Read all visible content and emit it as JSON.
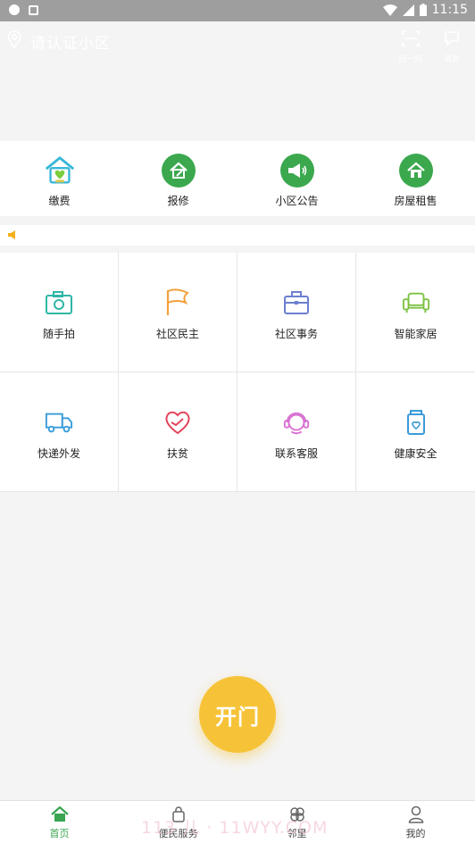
{
  "status_bar": {
    "time": "11:15"
  },
  "header": {
    "location_title": "请认证小区",
    "scan_label": "扫一扫",
    "message_label": "消息"
  },
  "quick_actions": [
    {
      "label": "缴费",
      "icon": "house-heart-icon"
    },
    {
      "label": "报修",
      "icon": "repair-house-icon"
    },
    {
      "label": "小区公告",
      "icon": "megaphone-icon"
    },
    {
      "label": "房屋租售",
      "icon": "home-icon"
    }
  ],
  "services": [
    {
      "label": "随手拍",
      "icon": "camera-icon"
    },
    {
      "label": "社区民主",
      "icon": "flag-icon"
    },
    {
      "label": "社区事务",
      "icon": "briefcase-icon"
    },
    {
      "label": "智能家居",
      "icon": "sofa-icon"
    },
    {
      "label": "快递外发",
      "icon": "truck-icon"
    },
    {
      "label": "扶贫",
      "icon": "heart-hand-icon"
    },
    {
      "label": "联系客服",
      "icon": "headset-icon"
    },
    {
      "label": "健康安全",
      "icon": "jar-icon"
    }
  ],
  "open_door_label": "开门",
  "watermark": "113 儿 · 11WYY.COM",
  "tabs": [
    {
      "label": "首页",
      "icon": "home-tab-icon",
      "active": true
    },
    {
      "label": "便民服务",
      "icon": "bag-icon",
      "active": false
    },
    {
      "label": "邻里",
      "icon": "clover-icon",
      "active": false
    },
    {
      "label": "我的",
      "icon": "user-icon",
      "active": false
    }
  ],
  "colors": {
    "accent_green": "#3aa551",
    "open_button": "#f6c338",
    "status_bar": "#9e9e9e"
  }
}
